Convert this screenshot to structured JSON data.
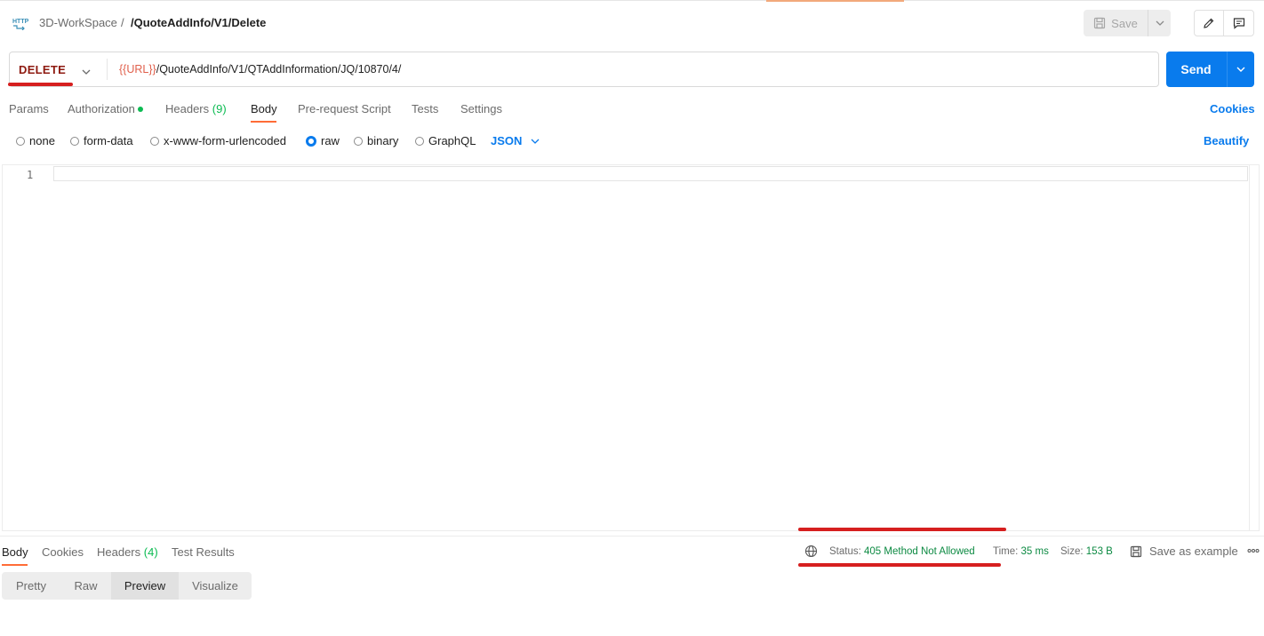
{
  "breadcrumb": {
    "workspace": "3D-WorkSpace",
    "separator": "/",
    "title": "/QuoteAddInfo/V1/Delete"
  },
  "toolbar": {
    "save_label": "Save"
  },
  "request": {
    "method": "DELETE",
    "url_variable": "{{URL}}",
    "url_path": "/QuoteAddInfo/V1/QTAddInformation/JQ/10870/4/",
    "send_label": "Send"
  },
  "request_tabs": {
    "params": "Params",
    "authorization": "Authorization",
    "headers": "Headers",
    "headers_count": "(9)",
    "body": "Body",
    "prerequest": "Pre-request Script",
    "tests": "Tests",
    "settings": "Settings",
    "cookies": "Cookies"
  },
  "body_types": {
    "none": "none",
    "form_data": "form-data",
    "urlencoded": "x-www-form-urlencoded",
    "raw": "raw",
    "binary": "binary",
    "graphql": "GraphQL",
    "selected": "raw",
    "format": "JSON",
    "beautify": "Beautify"
  },
  "editor": {
    "line_number": "1"
  },
  "response_tabs": {
    "body": "Body",
    "cookies": "Cookies",
    "headers": "Headers",
    "headers_count": "(4)",
    "test_results": "Test Results"
  },
  "response_status": {
    "status_label": "Status:",
    "status_value": "405 Method Not Allowed",
    "time_label": "Time:",
    "time_value": "35 ms",
    "size_label": "Size:",
    "size_value": "153 B",
    "save_example": "Save as example"
  },
  "view_modes": {
    "pretty": "Pretty",
    "raw": "Raw",
    "preview": "Preview",
    "visualize": "Visualize",
    "active": "Preview"
  },
  "colors": {
    "accent_orange": "#ff6c37",
    "send_blue": "#097bed",
    "method_red": "#8e1a10",
    "status_green": "#0c8a42",
    "annotation_red": "#d61f1f"
  }
}
